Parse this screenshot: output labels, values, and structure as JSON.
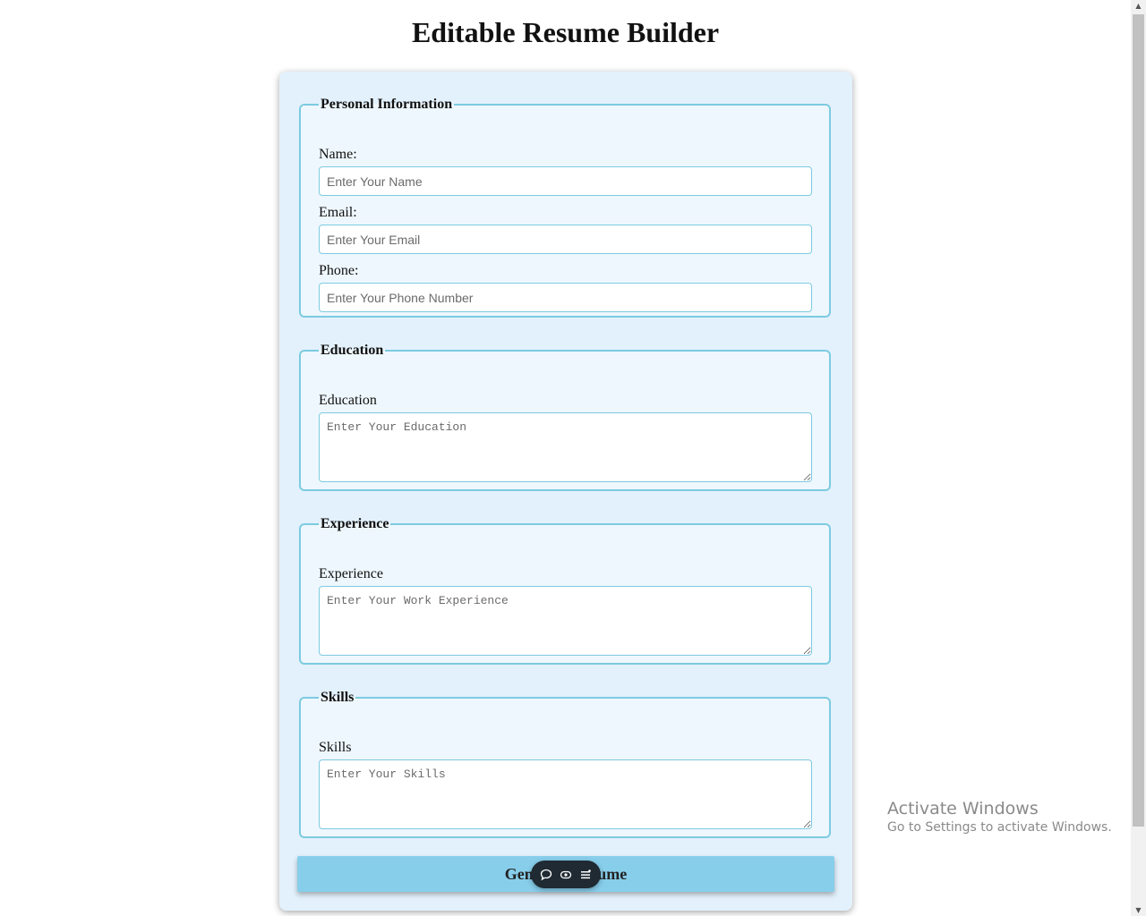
{
  "page": {
    "title": "Editable Resume Builder"
  },
  "personal": {
    "legend": "Personal Information",
    "name_label": "Name:",
    "name_placeholder": "Enter Your Name",
    "email_label": "Email:",
    "email_placeholder": "Enter Your Email",
    "phone_label": "Phone:",
    "phone_placeholder": "Enter Your Phone Number"
  },
  "education": {
    "legend": "Education",
    "label": "Education",
    "placeholder": "Enter Your Education"
  },
  "experience": {
    "legend": "Experience",
    "label": "Experience",
    "placeholder": "Enter Your Work Experience"
  },
  "skills": {
    "legend": "Skills",
    "label": "Skills",
    "placeholder": "Enter Your Skills"
  },
  "actions": {
    "generate_label": "Generate Resume"
  },
  "toolbar": {
    "icons": [
      "chat-icon",
      "eye-icon",
      "menu-icon"
    ]
  },
  "watermark": {
    "title": "Activate Windows",
    "subtitle": "Go to Settings to activate Windows."
  },
  "colors": {
    "card_bg": "#e3f1fc",
    "border_accent": "#7ccbe0",
    "button_bg": "#87ceeb",
    "toolbar_bg": "#1f2a32"
  }
}
